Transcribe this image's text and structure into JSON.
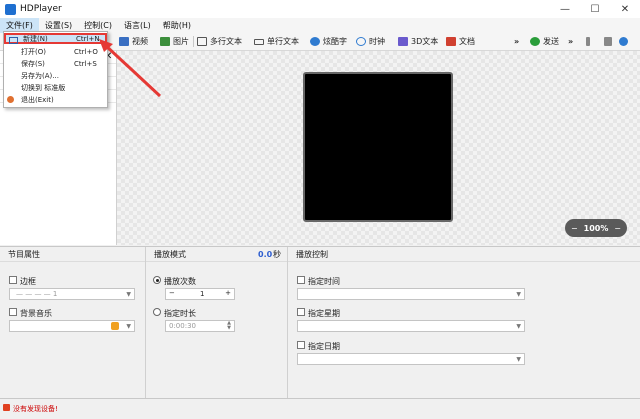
{
  "window": {
    "title": "HDPlayer",
    "controls": [
      "—",
      "☐",
      "✕"
    ]
  },
  "menu": {
    "items": [
      "文件(F)",
      "设置(S)",
      "控制(C)",
      "语言(L)",
      "帮助(H)"
    ]
  },
  "toolbar": {
    "video": "视频",
    "image": "图片",
    "multiline_text": "多行文本",
    "single_line_text": "单行文本",
    "animated_text": "炫酷字",
    "clock": "时钟",
    "text_3d": "3D文本",
    "document": "文档",
    "more": "»",
    "send": "发送",
    "more2": "»"
  },
  "file_menu": {
    "items": [
      {
        "label": "新建(N)",
        "shortcut": "Ctrl+N"
      },
      {
        "label": "打开(O)",
        "shortcut": "Ctrl+O"
      },
      {
        "label": "保存(S)",
        "shortcut": "Ctrl+S"
      },
      {
        "label": "另存为(A)...",
        "shortcut": ""
      },
      {
        "label": "切换到 标准版",
        "shortcut": ""
      },
      {
        "label": "退出(Exit)",
        "shortcut": ""
      }
    ]
  },
  "zoom": {
    "minus": "−",
    "value": "100%",
    "plus": "−"
  },
  "program_props": {
    "header": "节目属性",
    "border_label": "边框",
    "border_value": "— — — —   1",
    "bg_music_label": "背景音乐"
  },
  "play_mode": {
    "header": "播放模式",
    "duration_value": "0.0",
    "duration_unit": "秒",
    "play_count_label": "播放次数",
    "count_minus": "−",
    "count_value": "1",
    "count_plus": "+",
    "specify_duration_label": "指定时长",
    "duration_time": "0:00:30"
  },
  "play_control": {
    "header": "播放控制",
    "specify_time": "指定时间",
    "specify_week": "指定星期",
    "specify_date": "指定日期"
  },
  "status": {
    "text": "没有发现设备!"
  },
  "colors": {
    "highlight_border": "#e53935",
    "arrow": "#e53935",
    "status_red": "#cc0000"
  }
}
